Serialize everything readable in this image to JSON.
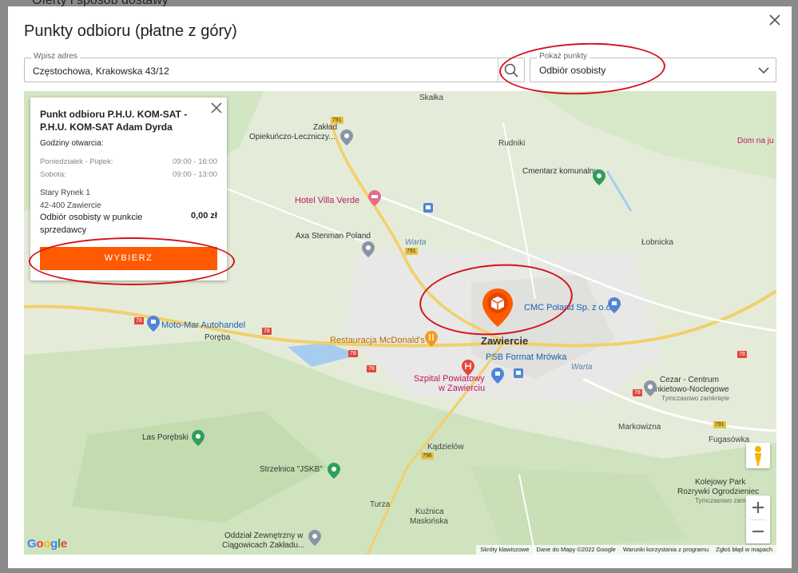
{
  "background": {
    "title": "Oferty i sposób dostawy"
  },
  "modal": {
    "title": "Punkty odbioru (płatne z góry)"
  },
  "address": {
    "label": "Wpisz adres",
    "value": "Częstochowa, Krakowska 43/12"
  },
  "points_select": {
    "label": "Pokaż punkty",
    "value": "Odbiór osobisty"
  },
  "info": {
    "title": "Punkt odbioru P.H.U. KOM-SAT - P.H.U. KOM-SAT Adam Dyrda",
    "hours_heading": "Godziny otwarcia:",
    "hours": [
      {
        "day": "Poniedziałek - Piątek:",
        "time": "09:00 - 16:00"
      },
      {
        "day": "Sobota:",
        "time": "09:00 - 13:00"
      }
    ],
    "street": "Stary Rynek 1",
    "city": "42-400 Zawiercie",
    "delivery_type": "Odbiór osobisty w punkcie sprzedawcy",
    "price": "0,00 zł",
    "button": "WYBIERZ"
  },
  "map": {
    "places": {
      "skalka": "Skałka",
      "zaklad1": "Zakład",
      "zaklad2": "Opiekuńczo-Leczniczy...",
      "rudniki": "Rudniki",
      "dom": "Dom na ju",
      "cmentarz": "Cmentarz komunalny",
      "hotel": "Hotel Villa Verde",
      "axa": "Axa Stenman Poland",
      "warta1": "Warta",
      "lobnicka": "Łobnicka",
      "cmc": "CMC Poland Sp. z o.o",
      "motomar": "Moto-Mar Autohandel",
      "poreba": "Poręba",
      "mcd": "Restauracja McDonald's",
      "zawiercie": "Zawiercie",
      "psb": "PSB Format Mrówka",
      "warta2": "Warta",
      "szpital1": "Szpital Powiatowy",
      "szpital2": "w Zawierciu",
      "cezar1": "Cezar - Centrum",
      "cezar2": "Bankietowo-Noclegowe",
      "cezar3": "Tymczasowo zamknięte",
      "markowizna": "Markowizna",
      "fugasowka": "Fugasówka",
      "las": "Las Porębski",
      "kadzielow": "Kądzielów",
      "strzelnica": "Strzelnica \"JSKB\"",
      "kolejowy1": "Kolejowy Park",
      "kolejowy2": "Rozrywki Ogrodzieniec",
      "kolejowy3": "Tymczasowo zamknięte",
      "turza": "Turza",
      "kuznica1": "Kuźnica",
      "kuznica2": "Masłońska",
      "oddzial1": "Oddział Zewnętrzny w",
      "oddzial2": "Ciągowicach Zakładu..."
    },
    "roads": {
      "r791a": "791",
      "r791b": "791",
      "r791c": "791",
      "r78a": "78",
      "r78b": "78",
      "r78c": "78",
      "r78d": "78",
      "r78e": "78",
      "r78f": "78",
      "r796": "796"
    },
    "attribution": [
      "Skróty klawiszowe",
      "Dane do Mapy ©2022 Google",
      "Warunki korzystania z programu",
      "Zgłoś błąd w mapach"
    ],
    "logo": "Google"
  },
  "colors": {
    "accent": "#ff5a00",
    "annotation": "#d2131b",
    "marker": "#ff5a00"
  }
}
